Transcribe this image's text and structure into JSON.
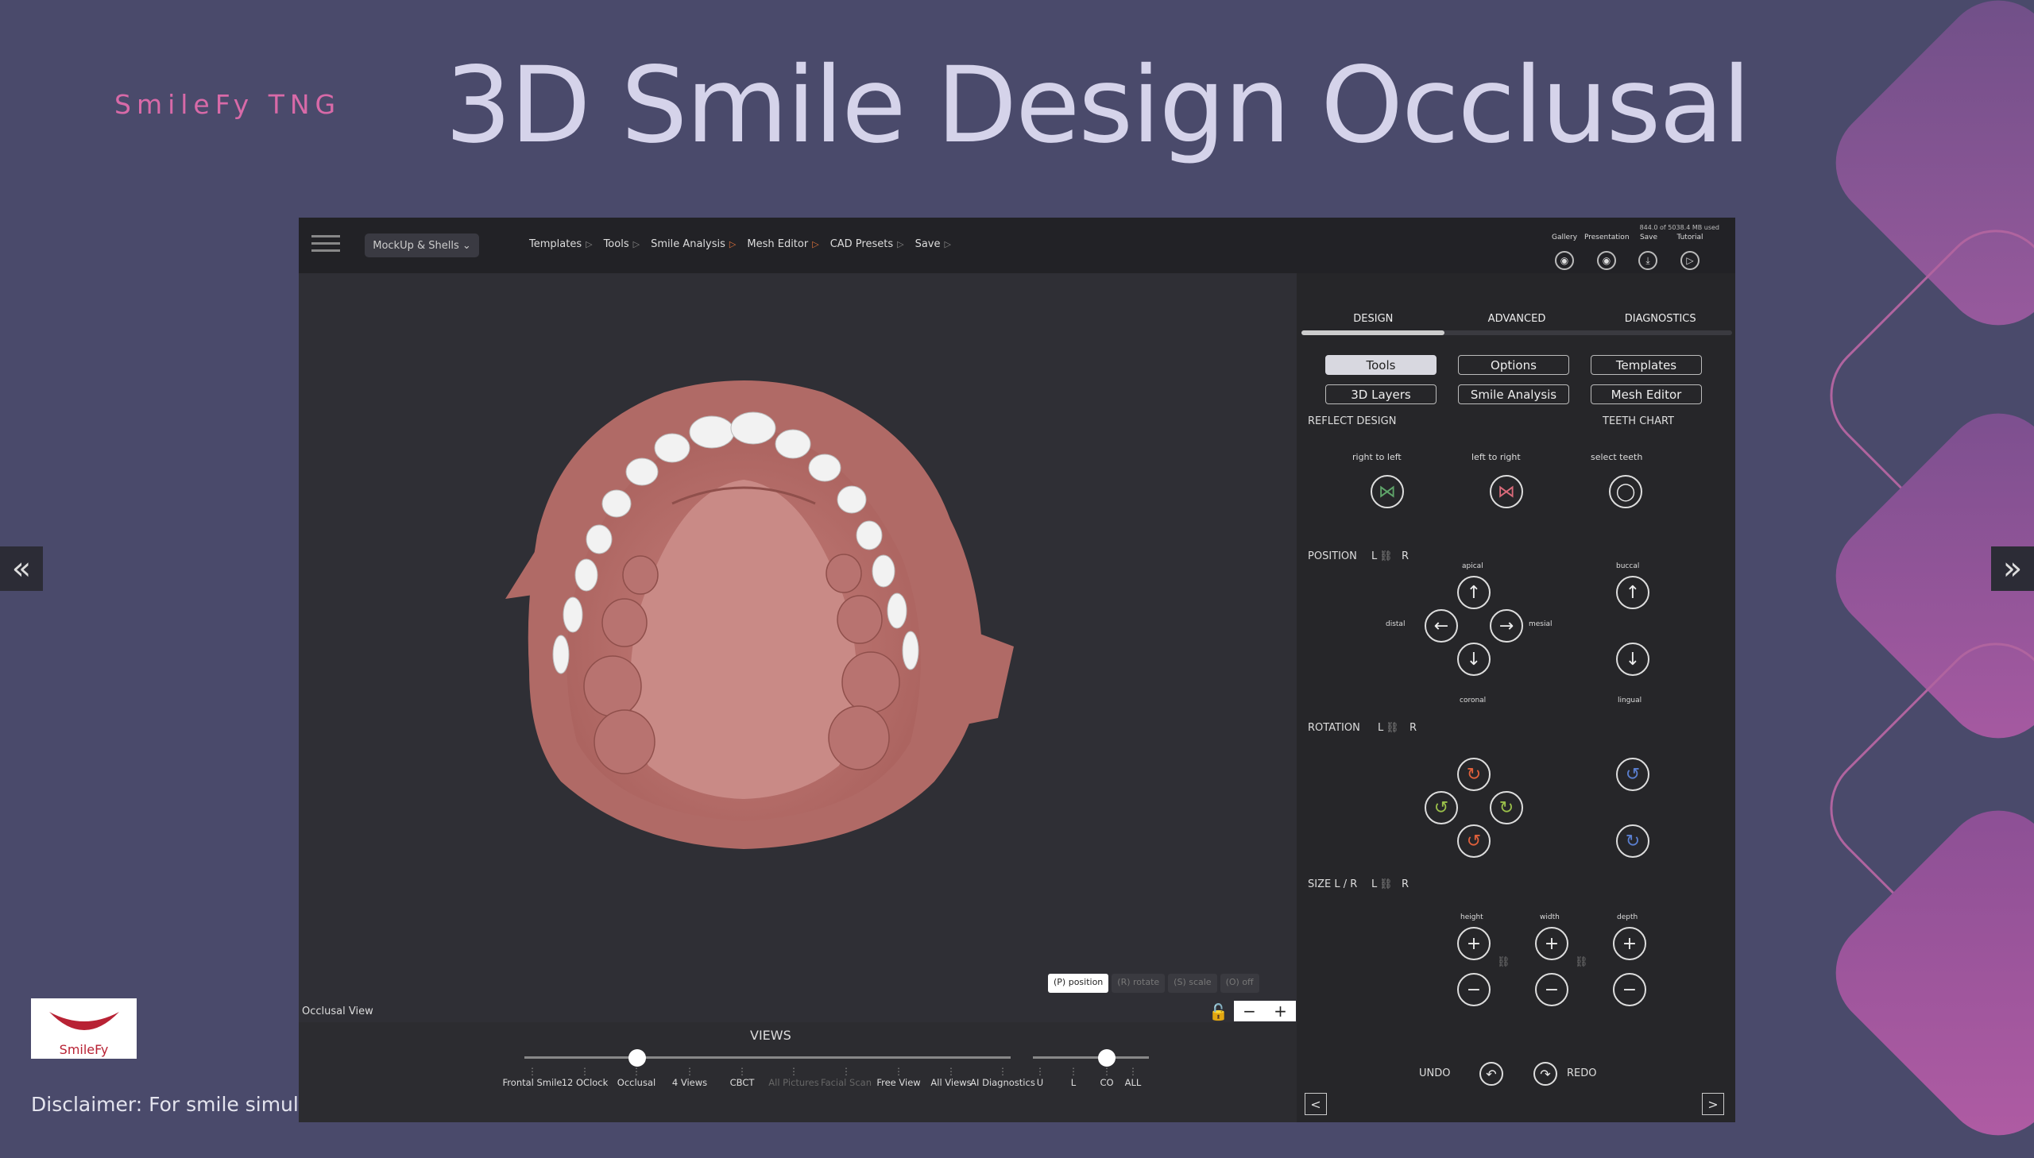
{
  "brand": "SmileFy TNG",
  "title": "3D Smile Design Occlusal",
  "disclaimer": "Disclaimer: For smile simulation purpuse only",
  "logo_text": "SmileFy",
  "nav": {
    "prev": "«",
    "next": "»"
  },
  "topbar": {
    "mockup_btn": "MockUp & Shells ⌄",
    "menu": [
      {
        "label": "Templates",
        "arrow": "▷"
      },
      {
        "label": "Tools",
        "arrow": "▷"
      },
      {
        "label": "Smile Analysis",
        "arrow": "▷"
      },
      {
        "label": "Mesh Editor",
        "arrow": "▷"
      },
      {
        "label": "CAD Presets",
        "arrow": "▷"
      },
      {
        "label": "Save",
        "arrow": "▷"
      }
    ],
    "usage": "844.0 of 5038.4 MB used",
    "right_labels": [
      "Gallery",
      "Presentation",
      "Save",
      "Tutorial"
    ],
    "right_icons": [
      "◉",
      "◉",
      "⤓",
      "▷"
    ]
  },
  "viewport": {
    "modes": [
      "(P) position",
      "(R) rotate",
      "(S) scale",
      "(O) off"
    ],
    "view_label": "Occlusal View",
    "lock": "🔓",
    "zoom_minus": "−",
    "zoom_plus": "+"
  },
  "views": {
    "title": "VIEWS",
    "ticks": [
      "Frontal Smile",
      "12 OClock",
      "Occlusal",
      "4 Views",
      "CBCT",
      "All Pictures",
      "Facial Scan",
      "Free View",
      "All Views",
      "AI Diagnostics"
    ],
    "arch_ticks": [
      "U",
      "L",
      "CO",
      "ALL"
    ]
  },
  "panel": {
    "tabs": [
      "DESIGN",
      "ADVANCED",
      "DIAGNOSTICS"
    ],
    "buttons": [
      "Tools",
      "Options",
      "Templates",
      "3D Layers",
      "Smile Analysis",
      "Mesh Editor"
    ],
    "reflect_design": "REFLECT DESIGN",
    "teeth_chart": "TEETH CHART",
    "right_to_left": "right to left",
    "left_to_right": "left to right",
    "select_teeth": "select teeth",
    "position": "POSITION",
    "rotation": "ROTATION",
    "size": "SIZE L / R",
    "L": "L",
    "R": "R",
    "link": "⛓",
    "apical": "apical",
    "coronal": "coronal",
    "distal": "distal",
    "mesial": "mesial",
    "buccal": "buccal",
    "lingual": "lingual",
    "height": "height",
    "width": "width",
    "depth": "depth",
    "undo": "UNDO",
    "redo": "REDO",
    "nav_prev": "<",
    "nav_next": ">",
    "arrow_up": "↑",
    "arrow_down": "↓",
    "arrow_left": "←",
    "arrow_right": "→",
    "plus": "+",
    "minus": "−",
    "reflect_icon": "⋈",
    "tooth_icon": "◯",
    "rot_icon_1": "↻",
    "rot_icon_2": "↺",
    "undo_icon": "↶",
    "redo_icon": "↷"
  }
}
